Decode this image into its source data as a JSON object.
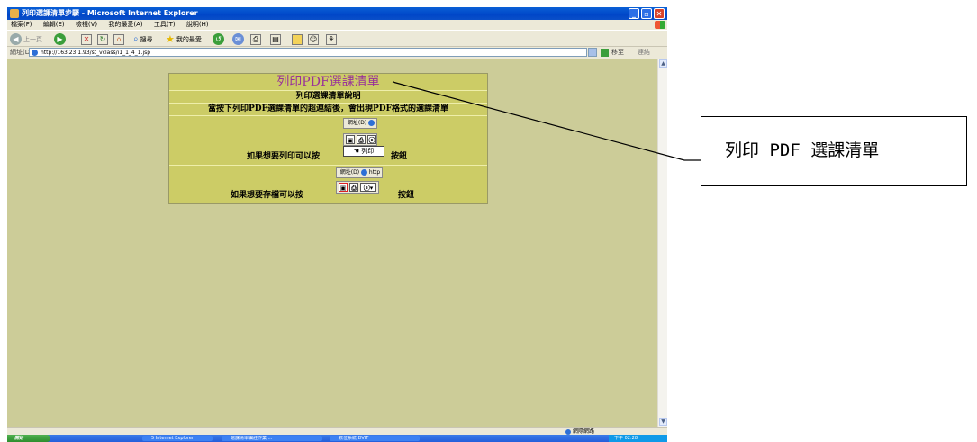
{
  "window": {
    "title": "列印選課清單步驟 - Microsoft Internet Explorer",
    "menu": [
      "檔案(F)",
      "編輯(E)",
      "檢視(V)",
      "我的最愛(A)",
      "工具(T)",
      "說明(H)"
    ],
    "toolbar": {
      "back_label": "上一頁",
      "search_label": "搜尋",
      "favorites_label": "我的最愛"
    },
    "address": {
      "label": "網址(D)",
      "url": "http://163.23.1.93/st_vclass/i1_1_4_1.jsp",
      "go_label": "移至",
      "links_label": "連結"
    },
    "status": {
      "zone": "網際網路"
    },
    "taskbar": {
      "start_label": "開始",
      "tasks": [
        "5 Internet Explorer",
        "選課清單編註作業 ...",
        "數位系統 DVIT"
      ],
      "clock": "下午 02:28"
    }
  },
  "page": {
    "title": "列印PDF選課清單",
    "subtitle": "列印選課清單說明",
    "instruction": "當按下列印PDF選課清單的超連結後，會出現PDF格式的選課清單",
    "print_block": {
      "mini_address_label": "網址(D)",
      "print_button_label": "列印",
      "caption_prefix": "如果想要列印可以按",
      "caption_suffix": "按鈕"
    },
    "save_block": {
      "mini_address_label": "網址(D)",
      "mini_url": "http",
      "caption_prefix": "如果想要存檔可以按",
      "caption_suffix": "按鈕"
    }
  },
  "callout": {
    "text": "列印 PDF 選課清單"
  },
  "colors": {
    "page_bg": "#cccc98",
    "table_bg": "#cccc66",
    "title": "#993399",
    "titlebar": "#0046c8"
  }
}
